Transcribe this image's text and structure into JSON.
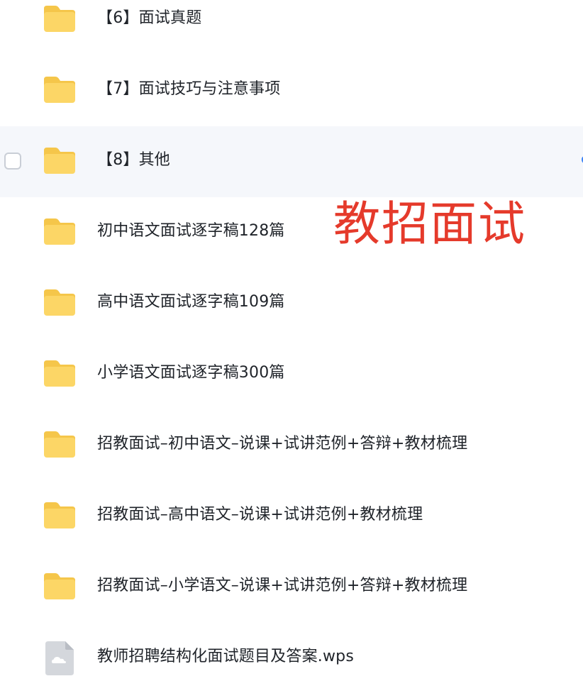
{
  "overlay": {
    "title": "教招面试",
    "color": "#e53a2b"
  },
  "icons": {
    "folder": "folder-icon",
    "document": "wps-document-icon"
  },
  "colors": {
    "folder_body": "#fcd666",
    "folder_back": "#f5c64a",
    "hover_row": "#f5f7fb",
    "text": "#1f2329"
  },
  "files": [
    {
      "name": "【6】面试真题",
      "type": "folder"
    },
    {
      "name": "【7】面试技巧与注意事项",
      "type": "folder"
    },
    {
      "name": "【8】其他",
      "type": "folder",
      "hovered": true
    },
    {
      "name": "初中语文面试逐字稿128篇",
      "type": "folder"
    },
    {
      "name": "高中语文面试逐字稿109篇",
      "type": "folder"
    },
    {
      "name": "小学语文面试逐字稿300篇",
      "type": "folder"
    },
    {
      "name": "招教面试–初中语文–说课+试讲范例+答辩+教材梳理",
      "type": "folder"
    },
    {
      "name": "招教面试–高中语文–说课+试讲范例+教材梳理",
      "type": "folder"
    },
    {
      "name": "招教面试–小学语文–说课+试讲范例+答辩+教材梳理",
      "type": "folder"
    },
    {
      "name": "教师招聘结构化面试题目及答案.wps",
      "type": "document"
    }
  ]
}
